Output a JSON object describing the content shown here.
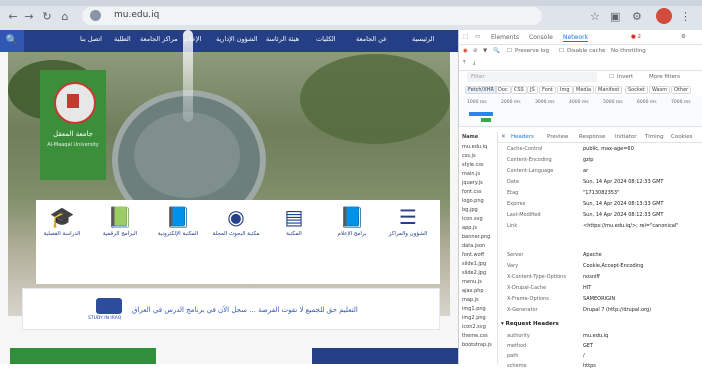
{
  "browser": {
    "url": "mu.edu.iq",
    "back_icon": "arrow-left",
    "forward_icon": "arrow-right",
    "reload_icon": "reload",
    "home_icon": "home"
  },
  "site": {
    "nav": [
      "الرئيسية",
      "عن الجامعة",
      "الكليات",
      "هيئة الرئاسة",
      "الشؤون الإدارية",
      "الإعلام",
      "مراكز الجامعة",
      "الطلبة",
      "اتصل بنا"
    ],
    "logo_name_ar": "جامعة المعقل",
    "logo_name_en": "Al-Maaqal University",
    "quick_links": [
      "الشؤون والمراكز",
      "برامج الإعلام",
      "المكتبة",
      "مكتبة البحوث المجلة",
      "المكتبة الإلكترونية",
      "البرامج الرقمية",
      "الدراسة الفصلية"
    ],
    "banner_text": "التعليم حق للجميع لا تفوت الفرصة ... سجل الآن في برنامج الدرس في العراق",
    "banner_logo_label": "STUDY IN IRAQ"
  },
  "devtools": {
    "tabs": [
      "Elements",
      "Console",
      "Network"
    ],
    "active_tab": "Network",
    "filter_placeholder": "Filter",
    "preserve_log": "Preserve log",
    "disable_cache": "Disable cache",
    "throttle": "No throttling",
    "invert": "Invert",
    "more_filters": "More filters",
    "types": [
      "Fetch/XHR",
      "Doc",
      "CSS",
      "JS",
      "Font",
      "Img",
      "Media",
      "Manifest",
      "Socket",
      "Wasm",
      "Other"
    ],
    "timeline_ticks": [
      "1000 ms",
      "2000 ms",
      "3000 ms",
      "4000 ms",
      "5000 ms",
      "6000 ms",
      "7000 ms"
    ],
    "name_header": "Name",
    "requests": [
      "mu.edu.iq",
      "css.js",
      "style.css",
      "main.js",
      "jquery.js",
      "font.css",
      "logo.png",
      "bg.jpg",
      "icon.svg",
      "app.js",
      "banner.png",
      "data.json",
      "font.woff",
      "slide1.jpg",
      "slide2.jpg",
      "menu.js",
      "ajax.php",
      "map.js",
      "img1.png",
      "img2.png",
      "icon2.svg",
      "theme.css",
      "bootstrap.js"
    ],
    "detail_tabs": [
      "Headers",
      "Preview",
      "Response",
      "Initiator",
      "Timing",
      "Cookies"
    ],
    "active_detail_tab": "Headers",
    "headers": [
      {
        "k": "Cache-Control",
        "v": "public, max-age=60"
      },
      {
        "k": "Content-Encoding",
        "v": "gzip"
      },
      {
        "k": "Content-Language",
        "v": "ar"
      },
      {
        "k": "Date",
        "v": "Sun, 14 Apr 2024 08:12:33 GMT"
      },
      {
        "k": "Etag",
        "v": "\"1713082353\""
      },
      {
        "k": "Expires",
        "v": "Sun, 14 Apr 2024 08:13:33 GMT"
      },
      {
        "k": "Last-Modified",
        "v": "Sun, 14 Apr 2024 08:12:33 GMT"
      },
      {
        "k": "Link",
        "v": "<https://mu.edu.iq/>; rel=\"canonical\""
      },
      {
        "k": "Server",
        "v": "Apache"
      },
      {
        "k": "Vary",
        "v": "Cookie,Accept-Encoding"
      },
      {
        "k": "X-Content-Type-Options",
        "v": "nosniff"
      },
      {
        "k": "X-Drupal-Cache",
        "v": "HIT"
      },
      {
        "k": "X-Frame-Options",
        "v": "SAMEORIGIN"
      },
      {
        "k": "X-Generator",
        "v": "Drupal 7 (http://drupal.org)"
      }
    ],
    "request_headers_title": "▾ Request Headers",
    "request_headers": [
      {
        "k": "authority",
        "v": "mu.edu.iq"
      },
      {
        "k": "method",
        "v": "GET"
      },
      {
        "k": "path",
        "v": "/"
      },
      {
        "k": "scheme",
        "v": "https"
      }
    ]
  }
}
